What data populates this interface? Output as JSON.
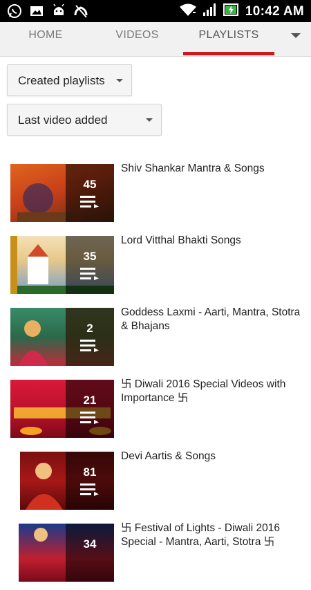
{
  "status_bar": {
    "time": "10:42 AM",
    "icons": [
      "whatsapp-icon",
      "gallery-icon",
      "android-icon",
      "missed-call-icon",
      "wifi-icon",
      "signal-icon",
      "battery-charging-icon"
    ]
  },
  "tabs": [
    {
      "label": "HOME",
      "active": false
    },
    {
      "label": "VIDEOS",
      "active": false
    },
    {
      "label": "PLAYLISTS",
      "active": true
    }
  ],
  "accent_color": "#cc181e",
  "filters": {
    "type_selected": "Created playlists",
    "sort_selected": "Last video added"
  },
  "playlists": [
    {
      "title": "Shiv Shankar Mantra & Songs",
      "count": "45"
    },
    {
      "title": "Lord Vitthal Bhakti Songs",
      "count": "35"
    },
    {
      "title": "Goddess Laxmi - Aarti, Mantra, Stotra & Bhajans",
      "count": "2"
    },
    {
      "title": "卐 Diwali 2016 Special Videos with Importance 卐",
      "count": "21"
    },
    {
      "title": "Devi Aartis & Songs",
      "count": "81"
    },
    {
      "title": "卐 Festival of Lights - Diwali 2016 Special - Mantra, Aarti, Stotra 卐",
      "count": "34"
    }
  ]
}
